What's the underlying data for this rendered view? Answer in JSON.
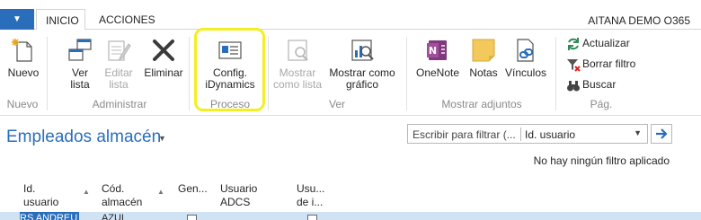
{
  "tabs": {
    "menu_arrow": "▼",
    "inicio": "INICIO",
    "acciones": "ACCIONES",
    "company": "AITANA DEMO O365"
  },
  "ribbon": {
    "nuevo_group": {
      "title": "Nuevo",
      "nuevo": "Nuevo"
    },
    "administrar": {
      "title": "Administrar",
      "ver_lista": [
        "Ver",
        "lista"
      ],
      "editar_lista": [
        "Editar",
        "lista"
      ],
      "eliminar": "Eliminar"
    },
    "proceso": {
      "title": "Proceso",
      "config": [
        "Config.",
        "iDynamics"
      ]
    },
    "ver": {
      "title": "Ver",
      "mostrar_lista": [
        "Mostrar",
        "como lista"
      ],
      "mostrar_grafico": [
        "Mostrar como",
        "gráfico"
      ]
    },
    "adjuntos": {
      "title": "Mostrar adjuntos",
      "onenote": "OneNote",
      "notas": "Notas",
      "vinculos": "Vínculos"
    },
    "pag": {
      "title": "Pág.",
      "actualizar": "Actualizar",
      "borrar_filtro": "Borrar filtro",
      "buscar": "Buscar"
    }
  },
  "page": {
    "title": "Empleados almacén",
    "filter_placeholder": "Escribir para filtrar (...",
    "filter_field": "Id. usuario",
    "no_filter": "No hay ningún filtro aplicado"
  },
  "grid": {
    "headers": {
      "id_usuario": [
        "Id.",
        "usuario"
      ],
      "cod_almacen": [
        "Cód.",
        "almacén"
      ],
      "gen": "Gen...",
      "usuario_adcs": [
        "Usuario",
        "ADCS"
      ],
      "usu_de_i": [
        "Usu...",
        "de i..."
      ]
    },
    "rows": [
      {
        "id_usuario": "RS ANDREU",
        "cod_almacen": "AZUL"
      }
    ]
  },
  "colors": {
    "accent": "#2a6ebb",
    "highlight": "#f4ee23"
  }
}
